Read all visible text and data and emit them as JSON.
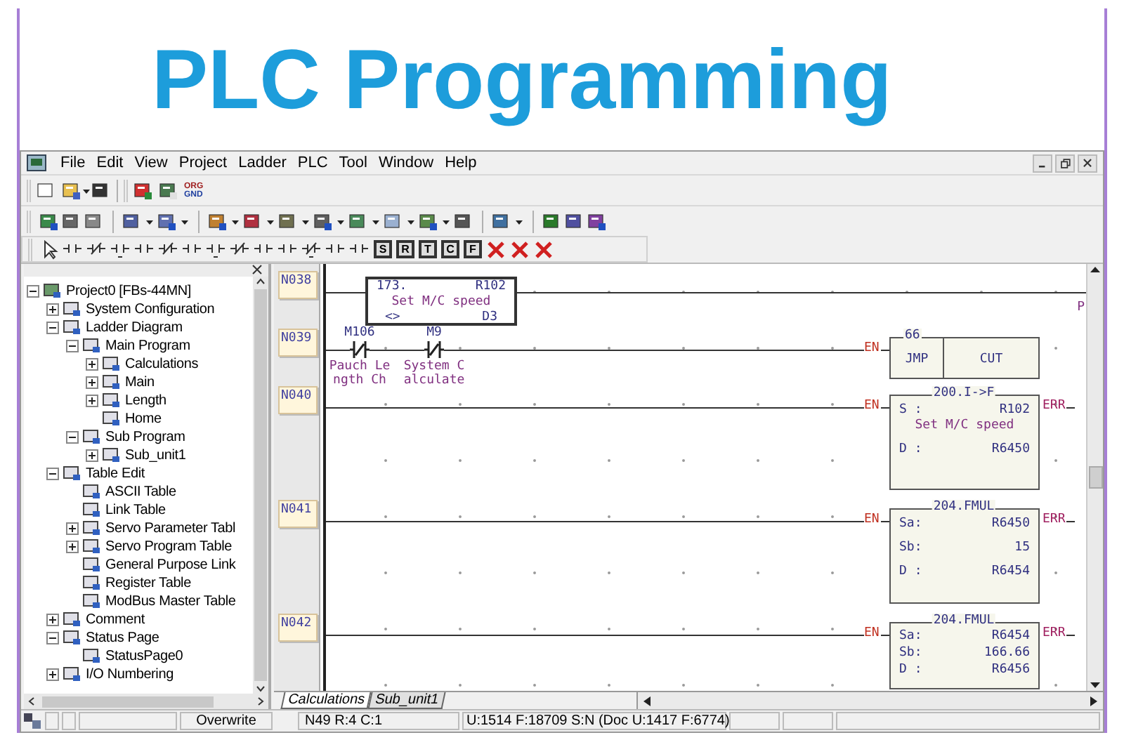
{
  "title": "PLC Programming",
  "menu": [
    "File",
    "Edit",
    "View",
    "Project",
    "Ladder",
    "PLC",
    "Tool",
    "Window",
    "Help"
  ],
  "toolbar1": {
    "org_gnd": [
      "ORG",
      "GND"
    ]
  },
  "toolbar3": {
    "letter_buttons": [
      "S",
      "R",
      "T",
      "C",
      "F"
    ]
  },
  "project_tree": {
    "items": [
      {
        "label": "Project0 [FBs-44MN]",
        "expanded": true,
        "children": [
          {
            "label": "System Configuration",
            "expanded": false
          },
          {
            "label": "Ladder Diagram",
            "expanded": true,
            "children": [
              {
                "label": "Main Program",
                "expanded": true,
                "children": [
                  {
                    "label": "Calculations",
                    "expanded": false
                  },
                  {
                    "label": "Main",
                    "expanded": false
                  },
                  {
                    "label": "Length",
                    "expanded": false
                  },
                  {
                    "label": "Home"
                  }
                ]
              },
              {
                "label": "Sub Program",
                "expanded": true,
                "children": [
                  {
                    "label": "Sub_unit1",
                    "expanded": false
                  }
                ]
              }
            ]
          },
          {
            "label": "Table Edit",
            "expanded": true,
            "children": [
              {
                "label": "ASCII Table"
              },
              {
                "label": "Link Table"
              },
              {
                "label": "Servo Parameter Tabl",
                "expanded": false
              },
              {
                "label": "Servo Program Table",
                "expanded": false
              },
              {
                "label": "General Purpose Link"
              },
              {
                "label": "Register Table"
              },
              {
                "label": "ModBus Master Table"
              }
            ]
          },
          {
            "label": "Comment",
            "expanded": false
          },
          {
            "label": "Status Page",
            "expanded": true,
            "children": [
              {
                "label": "StatusPage0"
              }
            ]
          },
          {
            "label": "I/O Numbering",
            "expanded": false
          }
        ]
      }
    ]
  },
  "ladder": {
    "rungs": [
      {
        "number": "N038",
        "elements": [
          {
            "kind": "function_call",
            "number": "173.",
            "address": "R102",
            "comment": "Set M/C speed",
            "operator": "<>",
            "operand": "D3"
          }
        ],
        "edge_text": "P"
      },
      {
        "number": "N039",
        "elements": [
          {
            "kind": "nc_contact",
            "address": "M106",
            "comment": [
              "Pauch Le",
              "ngth Ch"
            ]
          },
          {
            "kind": "nc_contact",
            "address": "M9",
            "comment": [
              "System C",
              "alculate"
            ]
          }
        ],
        "output": {
          "kind": "jump",
          "input": "EN",
          "number": "66",
          "instruction": "JMP",
          "label": "CUT"
        }
      },
      {
        "number": "N040",
        "output": {
          "kind": "function",
          "input": "EN",
          "error": "ERR",
          "title": "200.I->F",
          "operands": [
            {
              "name": "S :",
              "value": "R102",
              "comment": "Set M/C speed"
            },
            {
              "name": "D :",
              "value": "R6450"
            }
          ]
        }
      },
      {
        "number": "N041",
        "output": {
          "kind": "function",
          "input": "EN",
          "error": "ERR",
          "title": "204.FMUL",
          "operands": [
            {
              "name": "Sa:",
              "value": "R6450"
            },
            {
              "name": "Sb:",
              "value": "15"
            },
            {
              "name": "D :",
              "value": "R6454"
            }
          ]
        }
      },
      {
        "number": "N042",
        "output": {
          "kind": "function",
          "input": "EN",
          "error": "ERR",
          "title": "204.FMUL",
          "operands": [
            {
              "name": "Sa:",
              "value": "R6454"
            },
            {
              "name": "Sb:",
              "value": "166.66"
            },
            {
              "name": "D :",
              "value": "R6456"
            }
          ]
        }
      }
    ]
  },
  "tabs": [
    {
      "label": "Calculations",
      "selected": true
    },
    {
      "label": "Sub_unit1",
      "selected": false
    }
  ],
  "status_bar": {
    "mode": "Overwrite",
    "position": "N49 R:4 C:1",
    "memory": "U:1514 F:18709 S:N (Doc U:1417 F:6774)"
  }
}
